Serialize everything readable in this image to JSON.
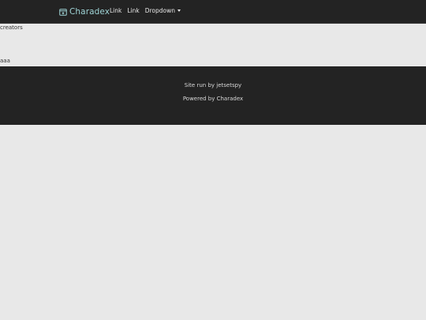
{
  "navbar": {
    "brand_label": "Charadex",
    "brand_icon": "box-icon",
    "links": [
      "Link",
      "Link"
    ],
    "dropdown_label": "Dropdown",
    "accent_color": "#9fd4d6",
    "background_color": "#232323"
  },
  "content": {
    "lines": [
      "creators",
      "aaa"
    ]
  },
  "footer": {
    "site_run_by": "Site run by jetsetspy",
    "powered_by": "Powered by Charadex"
  }
}
